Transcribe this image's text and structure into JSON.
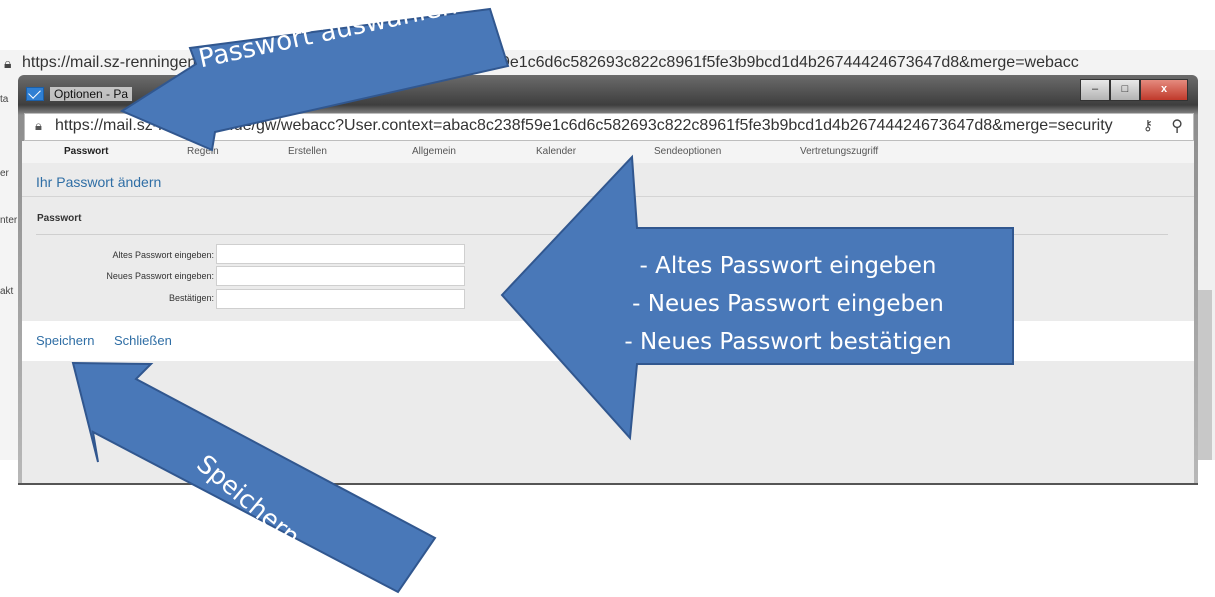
{
  "background": {
    "url": "https://mail.sz-renningen.de/gw/webacc?User.context=abac8c238f59e1c6d6c582693c822c8961f5fe3b9bcd1d4b26744424673647d8&merge=webacc",
    "side_fragments": [
      "ta",
      "er",
      "nter",
      "akt"
    ]
  },
  "window": {
    "title": "Optionen - Pa",
    "minimize": "–",
    "maximize": "□",
    "close": "x",
    "address_url": "https://mail.sz-renningen.de/gw/webacc?User.context=abac8c238f59e1c6d6c582693c822c8961f5fe3b9bcd1d4b26744424673647d8&merge=security"
  },
  "tabs": [
    "Passwort",
    "Regeln",
    "Erstellen",
    "Allgemein",
    "Kalender",
    "Sendeoptionen",
    "Vertretungszugriff"
  ],
  "heading": "Ihr Passwort ändern",
  "section": "Passwort",
  "fields": [
    {
      "label": "Altes Passwort eingeben:",
      "value": ""
    },
    {
      "label": "Neues Passwort eingeben:",
      "value": ""
    },
    {
      "label": "Bestätigen:",
      "value": ""
    }
  ],
  "actions": {
    "save": "Speichern",
    "close": "Schließen"
  },
  "annotations": {
    "arrow_top": "Passwort auswählen",
    "arrow_right_lines": [
      "- Altes Passwort eingeben",
      "- Neues Passwort eingeben",
      "- Neues Passwort bestätigen"
    ],
    "arrow_bottom": "Speichern"
  },
  "colors": {
    "arrow_fill": "#4978b8",
    "arrow_stroke": "#31578f",
    "link": "#2f6ea5"
  }
}
